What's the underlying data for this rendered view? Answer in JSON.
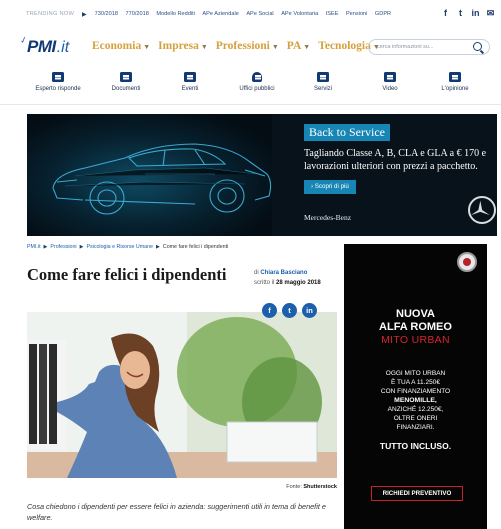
{
  "trending": {
    "label": "TRENDING NOW",
    "links": [
      "730/2018",
      "770/2018",
      "Modello Redditi",
      "APe Aziendale",
      "APe Social",
      "APe Volontaria",
      "ISEE",
      "Pensioni",
      "GDPR"
    ],
    "social_icons": [
      "facebook-icon",
      "twitter-icon",
      "linkedin-icon",
      "mail-icon"
    ]
  },
  "header": {
    "logo_main": "PMI",
    "logo_suffix": ".it",
    "menu": [
      "Economia",
      "Impresa",
      "Professioni",
      "PA",
      "Tecnologia"
    ],
    "search_placeholder": "cerca informazioni su..."
  },
  "categories": [
    {
      "label": "Esperto risponde",
      "icon": "chat-icon"
    },
    {
      "label": "Documenti",
      "icon": "folder-icon"
    },
    {
      "label": "Eventi",
      "icon": "calendar-icon"
    },
    {
      "label": "Uffici pubblici",
      "icon": "office-icon"
    },
    {
      "label": "Servizi",
      "icon": "grid-icon"
    },
    {
      "label": "Video",
      "icon": "play-icon"
    },
    {
      "label": "L'opinione",
      "icon": "document-icon"
    }
  ],
  "top_ad": {
    "title": "Back to Service",
    "text": "Tagliando Classe A, B, CLA e GLA a € 170 e lavorazioni ulteriori con prezzi a pacchetto.",
    "cta": "› Scopri di più",
    "brand": "Mercedes-Benz"
  },
  "breadcrumb": [
    "PMI.it",
    "Professioni",
    "Psicologia e Risorse Umane",
    "Come fare felici i dipendenti"
  ],
  "article": {
    "title": "Come fare felici i dipendenti",
    "by_prefix": "di",
    "author": "Chiara Basciano",
    "written_prefix": "scritto il",
    "date": "28 maggio 2018",
    "share_icons": [
      "facebook-icon",
      "twitter-icon",
      "linkedin-icon"
    ],
    "credit_prefix": "Fonte:",
    "credit_source": "Shutterstock",
    "lead": "Cosa chiedono i dipendenti per essere felici in azienda: suggerimenti utili in tema di benefit e welfare."
  },
  "side_ad": {
    "line1": "NUOVA",
    "line2": "ALFA ROMEO",
    "line3": "MITO URBAN",
    "offer_line1": "OGGI MITO URBAN",
    "offer_line2": "È TUA A 11.250€",
    "offer_line3": "CON FINANZIAMENTO",
    "offer_line4": "MENOMILLE,",
    "offer_line5": "ANZICHÉ 12.250€,",
    "offer_line6": "OLTRE ONERI",
    "offer_line7": "FINANZIARI.",
    "all_included": "TUTTO INCLUSO.",
    "cta": "RICHIEDI PREVENTIVO"
  },
  "colors": {
    "brand_navy": "#113a75",
    "link_blue": "#1c5fad",
    "menu_gold": "#d4a13d",
    "ad_accent": "#1786b5",
    "alfa_red": "#d2262e"
  }
}
